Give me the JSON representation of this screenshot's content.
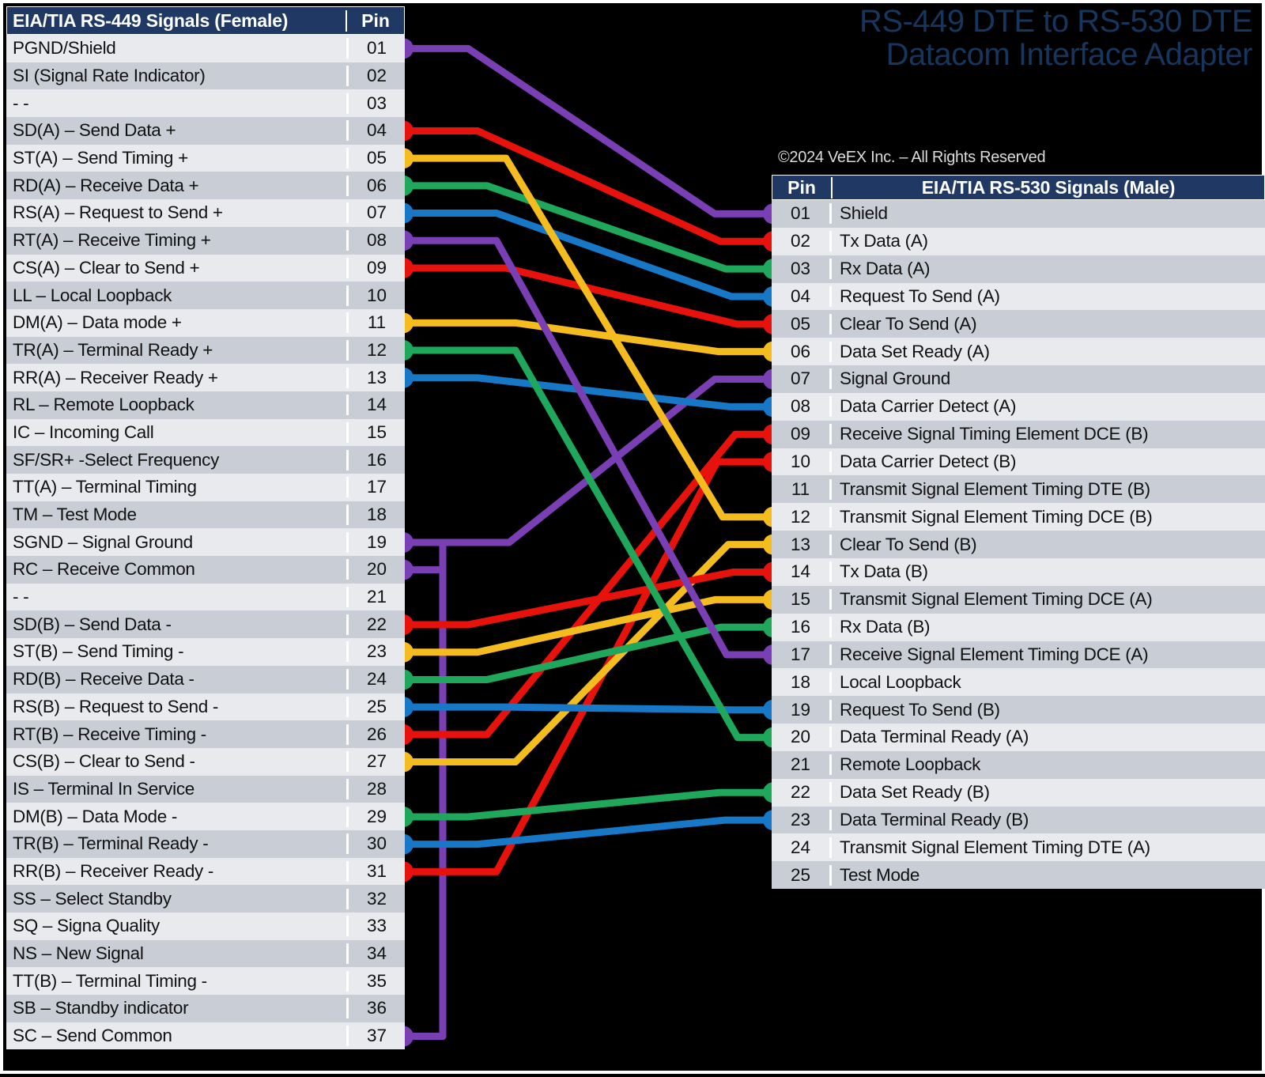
{
  "title": {
    "line1": "RS-449 DTE to RS-530 DTE",
    "line2": "Datacom Interface Adapter"
  },
  "copyright": "©2024 VeEX Inc. – All Rights Reserved",
  "colors": {
    "header_blue": "#1F3864",
    "title_blue": "#17365D",
    "background": "#000000",
    "row_light": "#E8EAEE",
    "row_dark": "#C9CDD6",
    "wire_red": "#E8120C",
    "wire_yellow": "#F5BC20",
    "wire_green": "#1FA85C",
    "wire_blue": "#1878C8",
    "wire_purple": "#7B3FB5"
  },
  "left_table": {
    "header": {
      "signal": "EIA/TIA RS-449 Signals (Female)",
      "pin": "Pin"
    },
    "rows": [
      {
        "pin": "01",
        "signal": "PGND/Shield",
        "dot": "purple"
      },
      {
        "pin": "02",
        "signal": "SI (Signal Rate Indicator)",
        "dot": null
      },
      {
        "pin": "03",
        "signal": "- -",
        "dot": null
      },
      {
        "pin": "04",
        "signal": "SD(A) – Send Data +",
        "dot": "red"
      },
      {
        "pin": "05",
        "signal": "ST(A) – Send Timing +",
        "dot": "yellow"
      },
      {
        "pin": "06",
        "signal": "RD(A) – Receive Data +",
        "dot": "green"
      },
      {
        "pin": "07",
        "signal": "RS(A) – Request to Send +",
        "dot": "blue"
      },
      {
        "pin": "08",
        "signal": "RT(A) – Receive Timing +",
        "dot": "purple"
      },
      {
        "pin": "09",
        "signal": "CS(A) – Clear to Send +",
        "dot": "red"
      },
      {
        "pin": "10",
        "signal": "LL – Local Loopback",
        "dot": null
      },
      {
        "pin": "11",
        "signal": "DM(A) – Data mode +",
        "dot": "yellow"
      },
      {
        "pin": "12",
        "signal": "TR(A) – Terminal Ready +",
        "dot": "green"
      },
      {
        "pin": "13",
        "signal": "RR(A) – Receiver Ready +",
        "dot": "blue"
      },
      {
        "pin": "14",
        "signal": "RL – Remote Loopback",
        "dot": null
      },
      {
        "pin": "15",
        "signal": "IC – Incoming Call",
        "dot": null
      },
      {
        "pin": "16",
        "signal": "SF/SR+ -Select Frequency",
        "dot": null
      },
      {
        "pin": "17",
        "signal": "TT(A) – Terminal Timing",
        "dot": null
      },
      {
        "pin": "18",
        "signal": "TM – Test Mode",
        "dot": null
      },
      {
        "pin": "19",
        "signal": "SGND – Signal Ground",
        "dot": "purple"
      },
      {
        "pin": "20",
        "signal": "RC – Receive Common",
        "dot": "purple"
      },
      {
        "pin": "21",
        "signal": "- -",
        "dot": null
      },
      {
        "pin": "22",
        "signal": "SD(B) – Send Data -",
        "dot": "red"
      },
      {
        "pin": "23",
        "signal": "ST(B) – Send Timing -",
        "dot": "yellow"
      },
      {
        "pin": "24",
        "signal": "RD(B) – Receive Data -",
        "dot": "green"
      },
      {
        "pin": "25",
        "signal": "RS(B) – Request to Send -",
        "dot": "blue"
      },
      {
        "pin": "26",
        "signal": "RT(B) – Receive Timing -",
        "dot": "red"
      },
      {
        "pin": "27",
        "signal": "CS(B) – Clear to Send -",
        "dot": "yellow"
      },
      {
        "pin": "28",
        "signal": "IS – Terminal In Service",
        "dot": null
      },
      {
        "pin": "29",
        "signal": "DM(B) – Data Mode -",
        "dot": "green"
      },
      {
        "pin": "30",
        "signal": "TR(B) – Terminal Ready -",
        "dot": "blue"
      },
      {
        "pin": "31",
        "signal": "RR(B) – Receiver Ready -",
        "dot": "red"
      },
      {
        "pin": "32",
        "signal": "SS – Select Standby",
        "dot": null
      },
      {
        "pin": "33",
        "signal": "SQ – Signa Quality",
        "dot": null
      },
      {
        "pin": "34",
        "signal": "NS – New Signal",
        "dot": null
      },
      {
        "pin": "35",
        "signal": "TT(B) – Terminal Timing -",
        "dot": null
      },
      {
        "pin": "36",
        "signal": "SB – Standby indicator",
        "dot": null
      },
      {
        "pin": "37",
        "signal": "SC – Send Common",
        "dot": "purple"
      }
    ]
  },
  "right_table": {
    "header": {
      "pin": "Pin",
      "signal": "EIA/TIA RS-530 Signals (Male)"
    },
    "rows": [
      {
        "pin": "01",
        "signal": "Shield",
        "dot": "purple"
      },
      {
        "pin": "02",
        "signal": "Tx Data (A)",
        "dot": "red"
      },
      {
        "pin": "03",
        "signal": "Rx Data (A)",
        "dot": "green"
      },
      {
        "pin": "04",
        "signal": "Request To Send (A)",
        "dot": "blue"
      },
      {
        "pin": "05",
        "signal": "Clear To Send (A)",
        "dot": "red"
      },
      {
        "pin": "06",
        "signal": "Data Set Ready (A)",
        "dot": "yellow"
      },
      {
        "pin": "07",
        "signal": "Signal Ground",
        "dot": "purple"
      },
      {
        "pin": "08",
        "signal": "Data Carrier Detect (A)",
        "dot": "blue"
      },
      {
        "pin": "09",
        "signal": "Receive Signal Timing Element DCE (B)",
        "dot": "red"
      },
      {
        "pin": "10",
        "signal": "Data Carrier Detect (B)",
        "dot": "red"
      },
      {
        "pin": "11",
        "signal": "Transmit Signal Element Timing DTE (B)",
        "dot": null
      },
      {
        "pin": "12",
        "signal": "Transmit Signal Element Timing DCE (B)",
        "dot": "yellow"
      },
      {
        "pin": "13",
        "signal": "Clear To Send (B)",
        "dot": "yellow"
      },
      {
        "pin": "14",
        "signal": "Tx Data (B)",
        "dot": "red"
      },
      {
        "pin": "15",
        "signal": "Transmit Signal Element Timing DCE (A)",
        "dot": "yellow"
      },
      {
        "pin": "16",
        "signal": "Rx Data (B)",
        "dot": "green"
      },
      {
        "pin": "17",
        "signal": "Receive Signal Element Timing DCE (A)",
        "dot": "purple"
      },
      {
        "pin": "18",
        "signal": "Local Loopback",
        "dot": null
      },
      {
        "pin": "19",
        "signal": "Request To Send (B)",
        "dot": "blue"
      },
      {
        "pin": "20",
        "signal": "Data Terminal Ready (A)",
        "dot": "green"
      },
      {
        "pin": "21",
        "signal": "Remote Loopback",
        "dot": null
      },
      {
        "pin": "22",
        "signal": "Data Set Ready (B)",
        "dot": "green"
      },
      {
        "pin": "23",
        "signal": "Data Terminal Ready (B)",
        "dot": "blue"
      },
      {
        "pin": "24",
        "signal": "Transmit Signal Element Timing DTE (A)",
        "dot": null
      },
      {
        "pin": "25",
        "signal": "Test Mode",
        "dot": null
      }
    ]
  },
  "connections": [
    {
      "left_pin": 1,
      "right_pin": 1,
      "color": "purple"
    },
    {
      "left_pin": 4,
      "right_pin": 2,
      "color": "red"
    },
    {
      "left_pin": 6,
      "right_pin": 3,
      "color": "green"
    },
    {
      "left_pin": 7,
      "right_pin": 4,
      "color": "blue"
    },
    {
      "left_pin": 9,
      "right_pin": 5,
      "color": "red"
    },
    {
      "left_pin": 11,
      "right_pin": 6,
      "color": "yellow"
    },
    {
      "left_pin": 19,
      "right_pin": 7,
      "color": "purple"
    },
    {
      "left_pin": 13,
      "right_pin": 8,
      "color": "blue"
    },
    {
      "left_pin": 26,
      "right_pin": 9,
      "color": "red"
    },
    {
      "left_pin": 31,
      "right_pin": 10,
      "color": "red"
    },
    {
      "left_pin": 5,
      "right_pin": 12,
      "color": "yellow"
    },
    {
      "left_pin": 27,
      "right_pin": 13,
      "color": "yellow"
    },
    {
      "left_pin": 22,
      "right_pin": 14,
      "color": "red"
    },
    {
      "left_pin": 23,
      "right_pin": 15,
      "color": "yellow"
    },
    {
      "left_pin": 24,
      "right_pin": 16,
      "color": "green"
    },
    {
      "left_pin": 8,
      "right_pin": 17,
      "color": "purple"
    },
    {
      "left_pin": 25,
      "right_pin": 19,
      "color": "blue"
    },
    {
      "left_pin": 12,
      "right_pin": 20,
      "color": "green"
    },
    {
      "left_pin": 29,
      "right_pin": 22,
      "color": "green"
    },
    {
      "left_pin": 30,
      "right_pin": 23,
      "color": "blue"
    },
    {
      "left_pin": 20,
      "right_pin": 7,
      "color": "purple"
    },
    {
      "left_pin": 37,
      "right_pin": 7,
      "color": "purple"
    }
  ]
}
